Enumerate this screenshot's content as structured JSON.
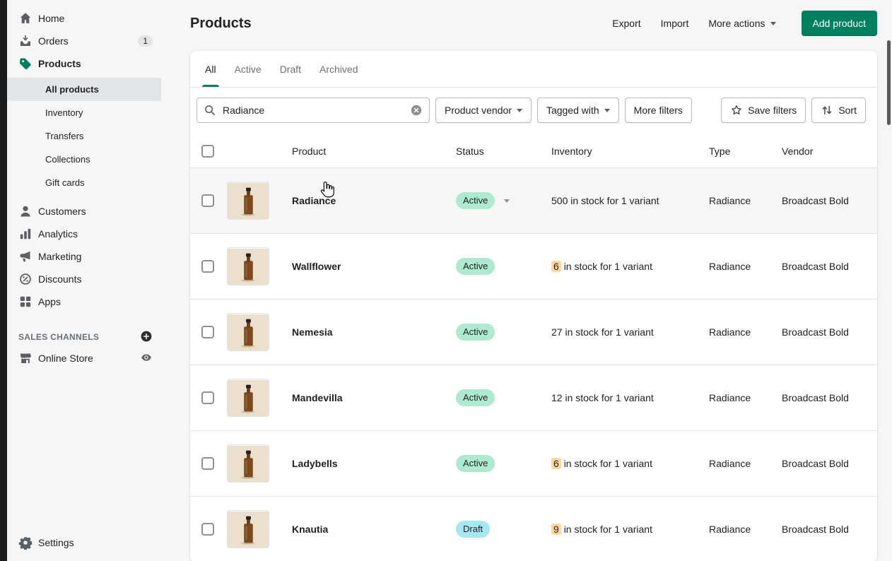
{
  "colors": {
    "accent_green": "#008060",
    "badge_success": "#aee9d1",
    "badge_info": "#a4e8f2",
    "low_stock_highlight": "#ffd79d"
  },
  "sidebar": {
    "home": "Home",
    "orders": "Orders",
    "orders_badge": "1",
    "products": "Products",
    "sub_all_products": "All products",
    "sub_inventory": "Inventory",
    "sub_transfers": "Transfers",
    "sub_collections": "Collections",
    "sub_gift_cards": "Gift cards",
    "customers": "Customers",
    "analytics": "Analytics",
    "marketing": "Marketing",
    "discounts": "Discounts",
    "apps": "Apps",
    "sales_channels": "SALES CHANNELS",
    "online_store": "Online Store",
    "settings": "Settings"
  },
  "header": {
    "title": "Products",
    "export": "Export",
    "import": "Import",
    "more_actions": "More actions",
    "add_product": "Add product"
  },
  "tabs": {
    "all": "All",
    "active": "Active",
    "draft": "Draft",
    "archived": "Archived"
  },
  "filters": {
    "search_value": "Radiance",
    "product_vendor": "Product vendor",
    "tagged_with": "Tagged with",
    "more_filters": "More filters",
    "save_filters": "Save filters",
    "sort": "Sort"
  },
  "table": {
    "columns": [
      "Product",
      "Status",
      "Inventory",
      "Type",
      "Vendor"
    ],
    "rows": [
      {
        "product": "Radiance",
        "status": "Active",
        "status_tone": "success",
        "status_caret": true,
        "inventory_qty": "500",
        "inventory_text": "in stock for 1 variant",
        "low_stock": false,
        "type": "Radiance",
        "vendor": "Broadcast Bold",
        "hovered": true
      },
      {
        "product": "Wallflower",
        "status": "Active",
        "status_tone": "success",
        "status_caret": false,
        "inventory_qty": "6",
        "inventory_text": "in stock for 1 variant",
        "low_stock": true,
        "type": "Radiance",
        "vendor": "Broadcast Bold",
        "hovered": false
      },
      {
        "product": "Nemesia",
        "status": "Active",
        "status_tone": "success",
        "status_caret": false,
        "inventory_qty": "27",
        "inventory_text": "in stock for 1 variant",
        "low_stock": false,
        "type": "Radiance",
        "vendor": "Broadcast Bold",
        "hovered": false
      },
      {
        "product": "Mandevilla",
        "status": "Active",
        "status_tone": "success",
        "status_caret": false,
        "inventory_qty": "12",
        "inventory_text": "in stock for 1 variant",
        "low_stock": false,
        "type": "Radiance",
        "vendor": "Broadcast Bold",
        "hovered": false
      },
      {
        "product": "Ladybells",
        "status": "Active",
        "status_tone": "success",
        "status_caret": false,
        "inventory_qty": "6",
        "inventory_text": "in stock for 1 variant",
        "low_stock": true,
        "type": "Radiance",
        "vendor": "Broadcast Bold",
        "hovered": false
      },
      {
        "product": "Knautia",
        "status": "Draft",
        "status_tone": "info",
        "status_caret": false,
        "inventory_qty": "9",
        "inventory_text": "in stock for 1 variant",
        "low_stock": true,
        "type": "Radiance",
        "vendor": "Broadcast Bold",
        "hovered": false
      }
    ]
  }
}
